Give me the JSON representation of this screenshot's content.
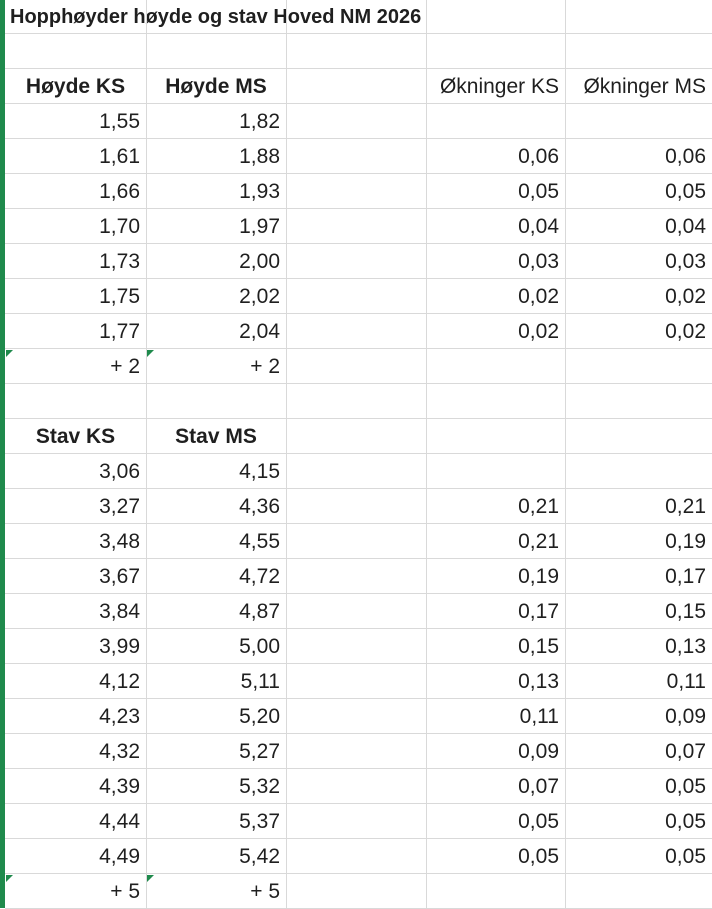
{
  "title": "Hopphøyder høyde og stav Hoved NM 2026",
  "headers_hoyde": {
    "ks": "Høyde KS",
    "ms": "Høyde MS",
    "okn_ks": "Økninger KS",
    "okn_ms": "Økninger MS"
  },
  "headers_stav": {
    "ks": "Stav KS",
    "ms": "Stav MS"
  },
  "hoyde_rows": [
    {
      "ks": "1,55",
      "ms": "1,82",
      "okn_ks": "",
      "okn_ms": ""
    },
    {
      "ks": "1,61",
      "ms": "1,88",
      "okn_ks": "0,06",
      "okn_ms": "0,06"
    },
    {
      "ks": "1,66",
      "ms": "1,93",
      "okn_ks": "0,05",
      "okn_ms": "0,05"
    },
    {
      "ks": "1,70",
      "ms": "1,97",
      "okn_ks": "0,04",
      "okn_ms": "0,04"
    },
    {
      "ks": "1,73",
      "ms": "2,00",
      "okn_ks": "0,03",
      "okn_ms": "0,03"
    },
    {
      "ks": "1,75",
      "ms": "2,02",
      "okn_ks": "0,02",
      "okn_ms": "0,02"
    },
    {
      "ks": "1,77",
      "ms": "2,04",
      "okn_ks": "0,02",
      "okn_ms": "0,02"
    }
  ],
  "hoyde_extra": {
    "ks": "+ 2",
    "ms": "+ 2"
  },
  "stav_rows": [
    {
      "ks": "3,06",
      "ms": "4,15",
      "okn_ks": "",
      "okn_ms": ""
    },
    {
      "ks": "3,27",
      "ms": "4,36",
      "okn_ks": "0,21",
      "okn_ms": "0,21"
    },
    {
      "ks": "3,48",
      "ms": "4,55",
      "okn_ks": "0,21",
      "okn_ms": "0,19"
    },
    {
      "ks": "3,67",
      "ms": "4,72",
      "okn_ks": "0,19",
      "okn_ms": "0,17"
    },
    {
      "ks": "3,84",
      "ms": "4,87",
      "okn_ks": "0,17",
      "okn_ms": "0,15"
    },
    {
      "ks": "3,99",
      "ms": "5,00",
      "okn_ks": "0,15",
      "okn_ms": "0,13"
    },
    {
      "ks": "4,12",
      "ms": "5,11",
      "okn_ks": "0,13",
      "okn_ms": "0,11"
    },
    {
      "ks": "4,23",
      "ms": "5,20",
      "okn_ks": "0,11",
      "okn_ms": "0,09"
    },
    {
      "ks": "4,32",
      "ms": "5,27",
      "okn_ks": "0,09",
      "okn_ms": "0,07"
    },
    {
      "ks": "4,39",
      "ms": "5,32",
      "okn_ks": "0,07",
      "okn_ms": "0,05"
    },
    {
      "ks": "4,44",
      "ms": "5,37",
      "okn_ks": "0,05",
      "okn_ms": "0,05"
    },
    {
      "ks": "4,49",
      "ms": "5,42",
      "okn_ks": "0,05",
      "okn_ms": "0,05"
    }
  ],
  "stav_extra": {
    "ks": "+ 5",
    "ms": "+ 5"
  },
  "colors": {
    "accent": "#1f8a4c",
    "gridline": "#d9d9d9"
  }
}
